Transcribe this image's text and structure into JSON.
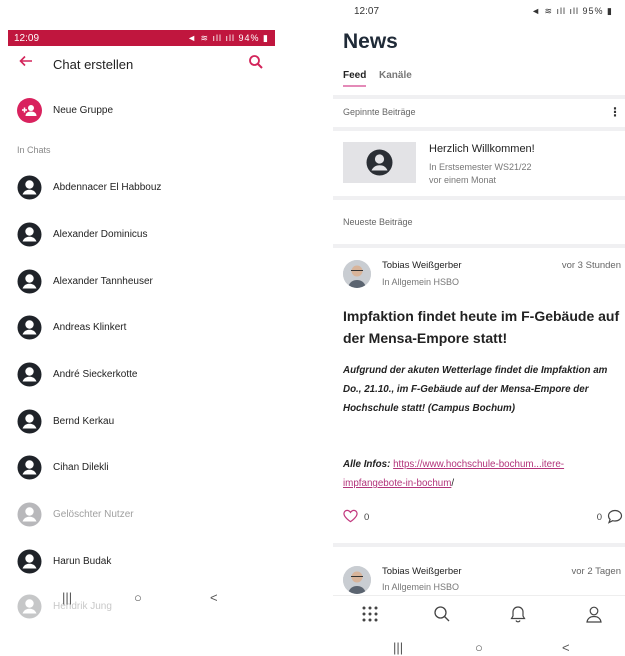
{
  "left": {
    "status": {
      "time": "12:09",
      "battery": "94%"
    },
    "header": {
      "title": "Chat erstellen"
    },
    "group": {
      "label": "Neue Gruppe"
    },
    "section": "In Chats",
    "contacts": [
      {
        "name": "Abdennacer El Habbouz"
      },
      {
        "name": "Alexander Dominicus"
      },
      {
        "name": "Alexander Tannheuser"
      },
      {
        "name": "Andreas Klinkert"
      },
      {
        "name": "André Sieckerkotte"
      },
      {
        "name": "Bernd Kerkau"
      },
      {
        "name": "Cihan Dilekli"
      },
      {
        "name": "Gelöschter Nutzer"
      },
      {
        "name": "Harun Budak"
      },
      {
        "name": "Hendrik Jung"
      }
    ],
    "nav": {
      "recents": "|||",
      "home": "○",
      "back": "<"
    }
  },
  "right": {
    "status": {
      "time": "12:07",
      "battery": "95%"
    },
    "title": "News",
    "tabs": [
      {
        "label": "Feed"
      },
      {
        "label": "Kanäle"
      }
    ],
    "pinned_label": "Gepinnte Beiträge",
    "pinned": {
      "title": "Herzlich Willkommen!",
      "channel": "In Erstsemester WS21/22",
      "time": "vor einem Monat"
    },
    "newest_label": "Neueste Beiträge",
    "posts": [
      {
        "author": "Tobias Weißgerber",
        "channel": "In Allgemein HSBO",
        "time": "vor 3 Stunden",
        "headline": "Impfaktion findet heute im F-Gebäude auf der Mensa-Empore statt!",
        "lead": "Aufgrund der akuten Wetterlage findet die Impfaktion am Do., 21.10., im F-Gebäude auf der Mensa-Empore der Hochschule statt! (Campus Bochum)",
        "infos_label": "Alle Infos:",
        "link": "https://www.hochschule-bochum...itere-impfangebote-in-bochum",
        "link_suffix": "/",
        "likes": "0",
        "comments": "0"
      },
      {
        "author": "Tobias Weißgerber",
        "channel": "In Allgemein HSBO",
        "time": "vor 2 Tagen"
      }
    ],
    "sysnav": {
      "recents": "|||",
      "home": "○",
      "back": "<"
    },
    "accent": "#d3245a",
    "link_color": "#b2337a"
  }
}
